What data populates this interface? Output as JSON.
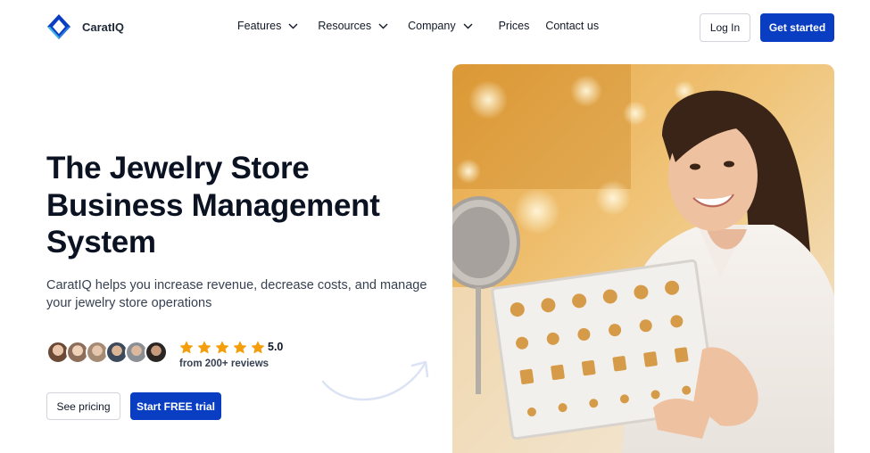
{
  "header": {
    "brand": "CaratIQ",
    "nav": [
      {
        "label": "Features",
        "has_dropdown": true
      },
      {
        "label": "Resources",
        "has_dropdown": true
      },
      {
        "label": "Company",
        "has_dropdown": true
      },
      {
        "label": "Prices",
        "has_dropdown": false
      },
      {
        "label": "Contact us",
        "has_dropdown": false
      }
    ],
    "login_label": "Log In",
    "cta_label": "Get started"
  },
  "hero": {
    "title_lines": [
      "The Jewelry Store",
      "Business Management",
      "System"
    ],
    "subtitle": "CaratIQ helps you increase revenue, decrease costs, and manage your jewelry store operations",
    "rating": {
      "stars": 5,
      "score": "5.0",
      "reviews": "from 200+ reviews"
    },
    "buttons": {
      "pricing_label": "See pricing",
      "trial_label": "Start FREE trial"
    }
  },
  "colors": {
    "primary": "#0a3ec2",
    "star": "#f59e0b",
    "text": "#0b1222"
  }
}
